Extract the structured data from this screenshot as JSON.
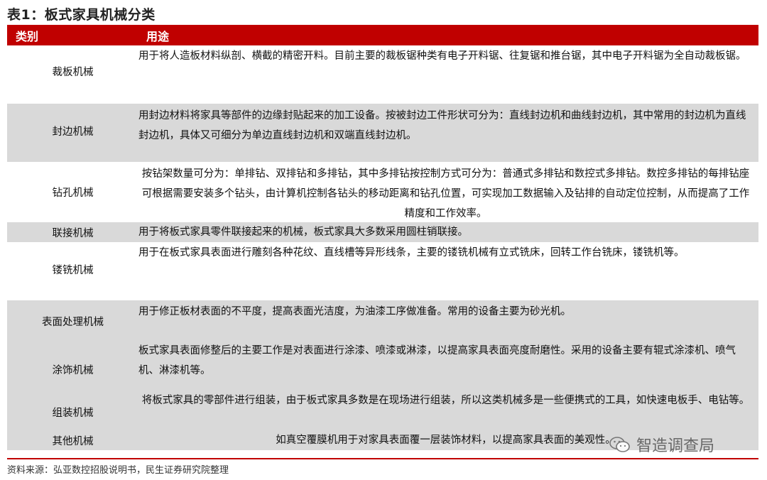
{
  "title": "表1：板式家具机械分类",
  "header": {
    "category": "类别",
    "usage": "用途"
  },
  "rows": [
    {
      "category": "裁板机械",
      "usage": "用于将人造板材料纵剖、横截的精密开料。目前主要的裁板锯种类有电子开料锯、往复锯和推台锯，其中电子开料锯为全自动裁板锯。"
    },
    {
      "category": "封边机械",
      "usage": "用封边材料将家具等部件的边缘封贴起来的加工设备。按被封边工件形状可分为：直线封边机和曲线封边机，其中常用的封边机为直线封边机，具体又可细分为单边直线封边机和双端直线封边机。"
    },
    {
      "category": "钻孔机械",
      "usage": "按钻架数量可分为：单排钻、双排钻和多排钻，其中多排钻按控制方式可分为：普通式多排钻和数控式多排钻。数控多排钻的每排钻座可根据需要安装多个钻头，由计算机控制各钻头的移动距离和钻孔位置，可实现加工数据输入及钻排的自动定位控制，从而提高了工作精度和工作效率。"
    },
    {
      "category": "联接机械",
      "usage": "用于将板式家具零件联接起来的机械，板式家具大多数采用圆柱销联接。"
    },
    {
      "category": "镂铣机械",
      "usage": "用于在板式家具表面进行雕刻各种花纹、直线槽等异形线条，主要的镂铣机械有立式铣床，回转工作台铣床，镂铣机等。"
    },
    {
      "category": "表面处理机械",
      "usage": "用于修正板材表面的不平度，提高表面光洁度，为油漆工序做准备。常用的设备主要为砂光机。"
    },
    {
      "category": "涂饰机械",
      "usage": "板式家具表面修整后的主要工作是对表面进行涂漆、喷漆或淋漆，以提高家具表面亮度耐磨性。采用的设备主要有辊式涂漆机、喷气机、淋漆机等。"
    },
    {
      "category": "组装机械",
      "usage": "将板式家具的零部件进行组装，由于板式家具多数是在现场进行组装，所以这类机械多是一些便携式的工具，如快速电板手、电钻等。"
    },
    {
      "category": "其他机械",
      "usage": "如真空覆膜机用于对家具表面覆一层装饰材料，以提高家具表面的美观性。"
    }
  ],
  "source": "资料来源：弘亚数控招股说明书，民生证券研究院整理",
  "watermark": "智造调查局",
  "watermark_icon": "wechat-icon"
}
